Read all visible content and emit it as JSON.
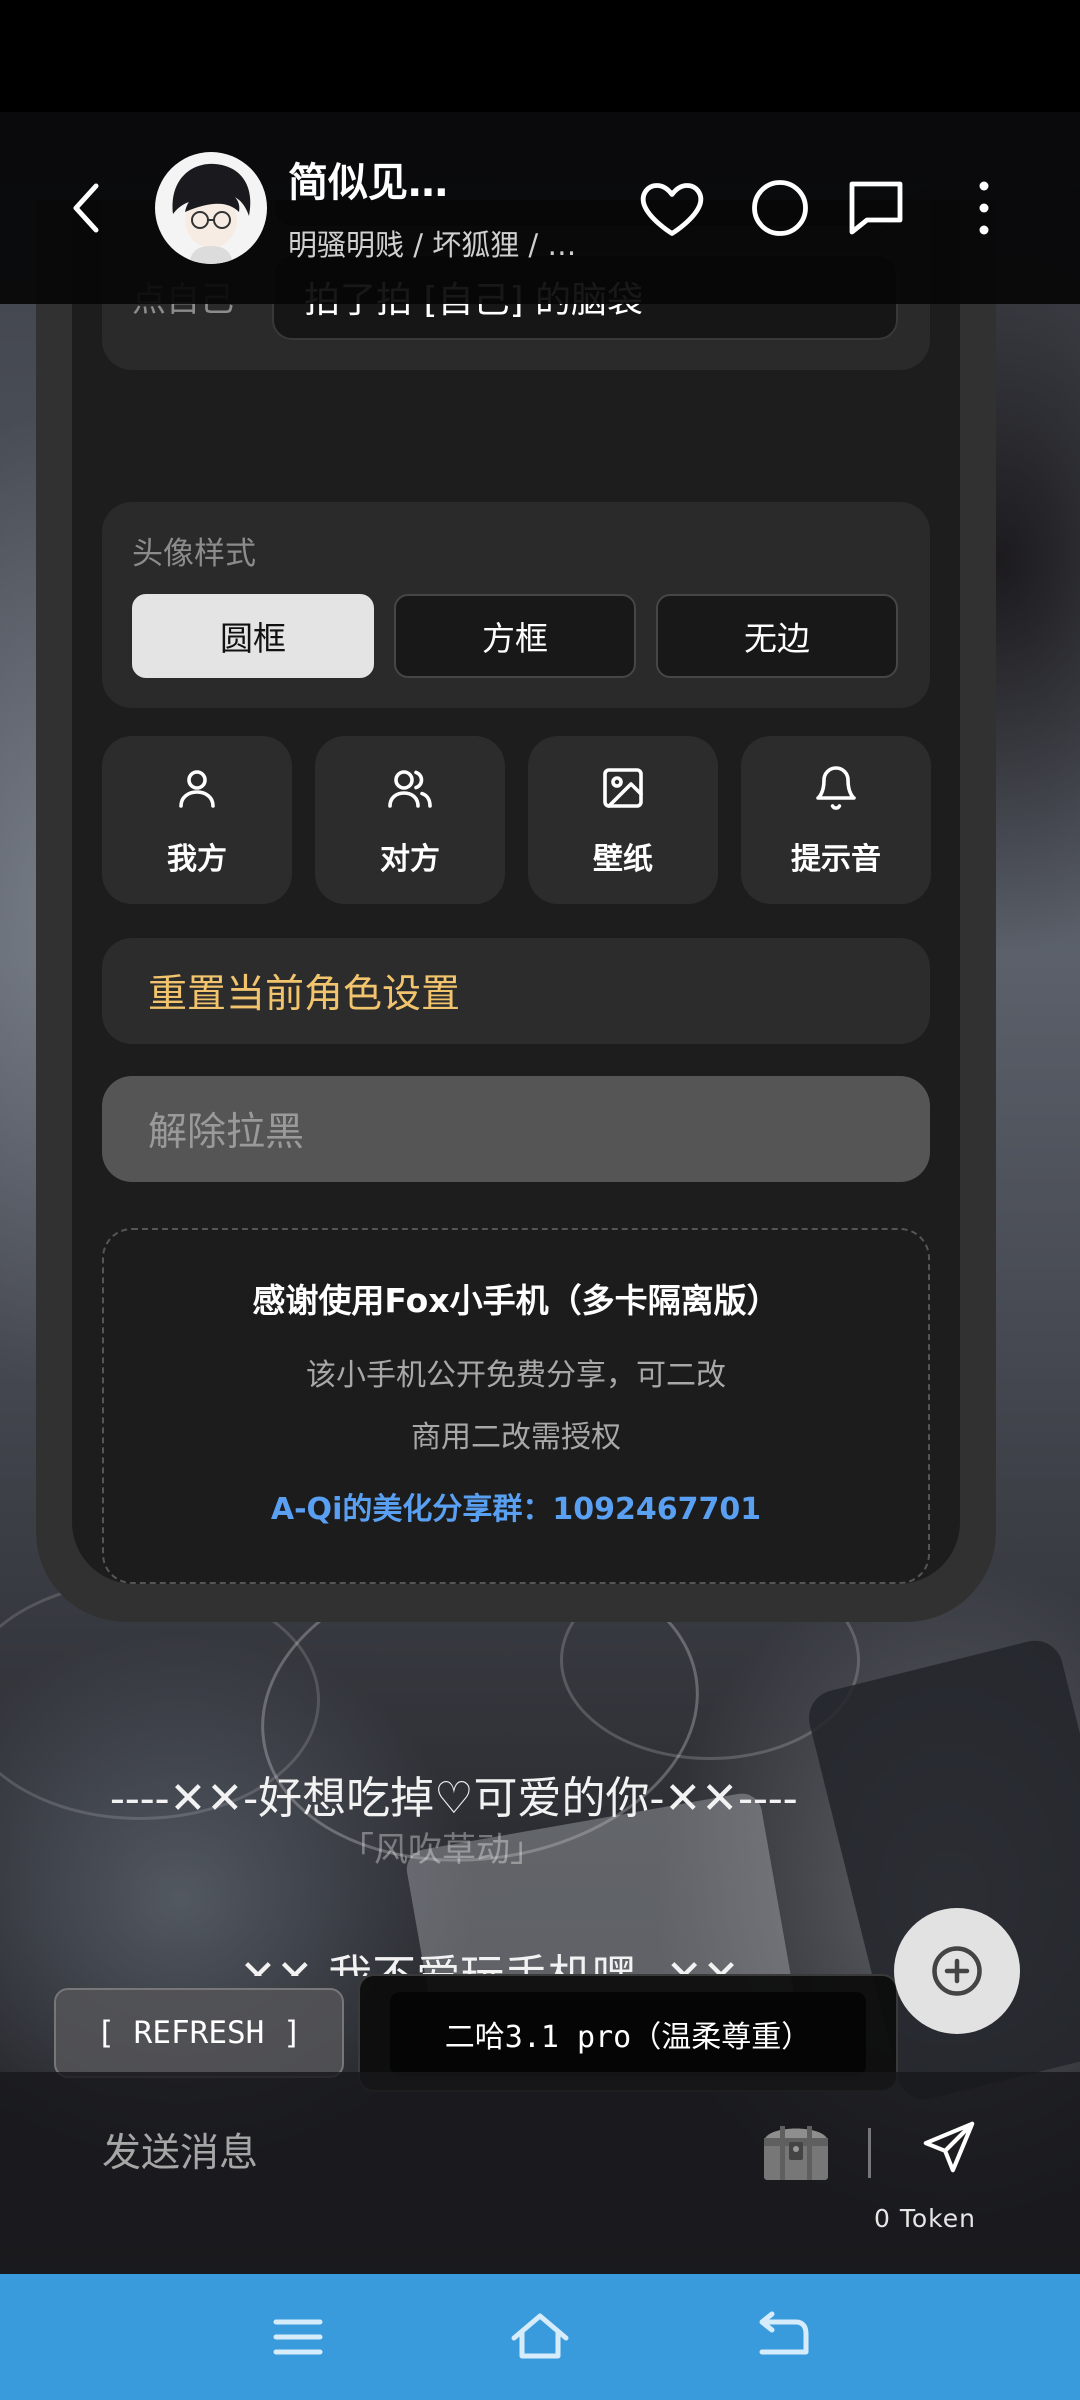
{
  "header": {
    "title": "简似见…",
    "subtitle": "明骚明贱 / 坏狐狸 / …"
  },
  "settings": {
    "pat_self_label": "点自己",
    "pat_self_value": "拍了拍 [自己] 的脑袋",
    "avatar_style": {
      "label": "头像样式",
      "options": [
        "圆框",
        "方框",
        "无边"
      ],
      "selected": "圆框"
    },
    "tiles": [
      {
        "label": "我方",
        "icon": "user-icon"
      },
      {
        "label": "对方",
        "icon": "users-icon"
      },
      {
        "label": "壁纸",
        "icon": "image-icon"
      },
      {
        "label": "提示音",
        "icon": "bell-icon"
      }
    ],
    "reset_label": "重置当前角色设置",
    "unblock_label": "解除拉黑"
  },
  "credits": {
    "title": "感谢使用Fox小手机（多卡隔离版）",
    "line1": "该小手机公开免费分享，可二改",
    "line2": "商用二改需授权",
    "group": "A-Qi的美化分享群：1092467701"
  },
  "chat": {
    "deco_line1": "----✕✕-好想吃掉♡可爱的你-✕✕----",
    "deco_line2": "----✕✕-我不爱玩手机嘿--✕✕----",
    "watermark": "「风吹草动」"
  },
  "controls": {
    "refresh_label": "[ REFRESH ]",
    "model_label": "二哈3.1 pro（温柔尊重）"
  },
  "composer": {
    "placeholder": "发送消息",
    "token_label": "0 Token"
  },
  "colors": {
    "accent_gold": "#f2c46d",
    "accent_blue": "#5aa0f2",
    "nav_bar": "#3a9bdc"
  }
}
